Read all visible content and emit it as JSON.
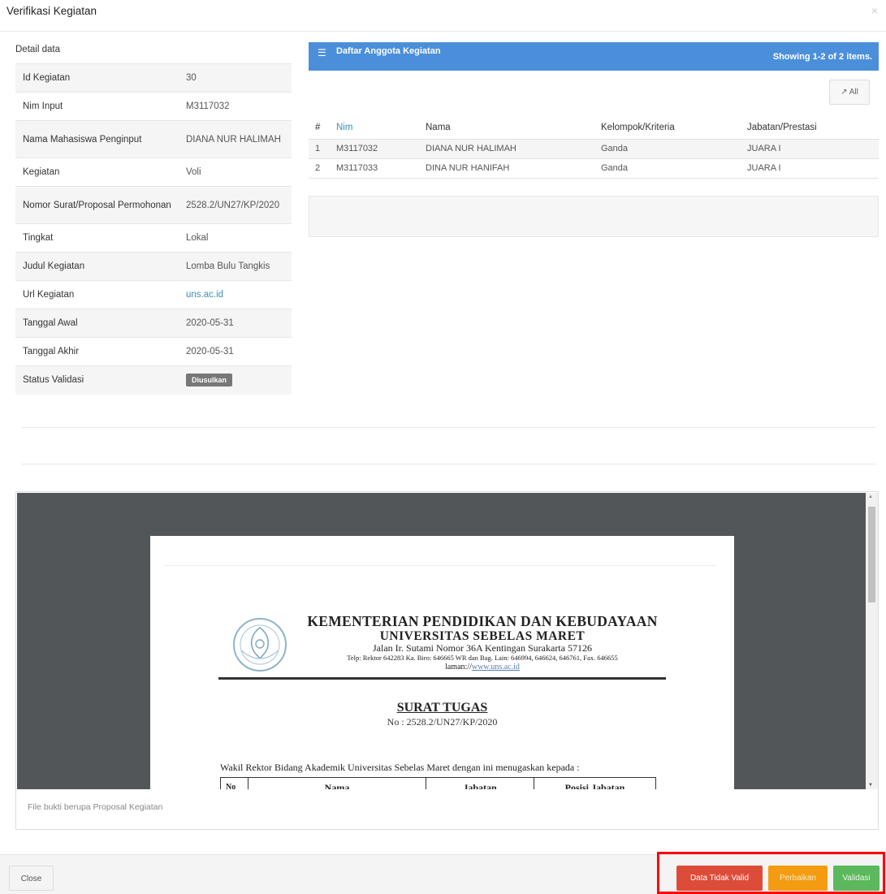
{
  "modal": {
    "title": "Verifikasi Kegiatan",
    "close_glyph": "×"
  },
  "detail": {
    "caption": "Detail data",
    "rows": [
      {
        "label": "Id Kegiatan",
        "value": "30"
      },
      {
        "label": "Nim Input",
        "value": "M3117032"
      },
      {
        "label": "Nama Mahasiswa Penginput",
        "value": "DIANA NUR HALIMAH"
      },
      {
        "label": "Kegiatan",
        "value": "Voli"
      },
      {
        "label": "Nomor Surat/Proposal Permohonan",
        "value": "2528.2/UN27/KP/2020"
      },
      {
        "label": "Tingkat",
        "value": "Lokal"
      },
      {
        "label": "Judul Kegiatan",
        "value": "Lomba Bulu Tangkis"
      },
      {
        "label": "Url Kegiatan",
        "value": "uns.ac.id"
      },
      {
        "label": "Tanggal Awal",
        "value": "2020-05-31"
      },
      {
        "label": "Tanggal Akhir",
        "value": "2020-05-31"
      },
      {
        "label": "Status Validasi",
        "value": "Diusulkan"
      }
    ]
  },
  "anggota": {
    "title": "Daftar Anggota Kegiatan",
    "summary": "Showing 1-2 of 2 items.",
    "expand_label": "All",
    "columns": [
      "#",
      "Nim",
      "Nama",
      "Kelompok/Kriteria",
      "Jabatan/Prestasi"
    ],
    "rows": [
      {
        "no": "1",
        "nim": "M3117032",
        "nama": "DIANA NUR HALIMAH",
        "kelompok": "Ganda",
        "jabatan": "JUARA I"
      },
      {
        "no": "2",
        "nim": "M3117033",
        "nama": "DINA NUR HANIFAH",
        "kelompok": "Ganda",
        "jabatan": "JUARA I"
      }
    ]
  },
  "document": {
    "line1": "KEMENTERIAN PENDIDIKAN DAN KEBUDAYAAN",
    "line2": "UNIVERSITAS SEBELAS MARET",
    "line3": "Jalan Ir. Sutami Nomor 36A Kentingan Surakarta 57126",
    "line4": "Telp: Rektor 642283 Ka. Biro: 646665 WR dan Bag. Lain: 646994, 646624, 646761, Fax. 646655",
    "line5_prefix": "laman://",
    "line5_url": "www.uns.ac.id",
    "title": "SURAT TUGAS",
    "number": "No : 2528.2/UN27/KP/2020",
    "intro": "Wakil Rektor Bidang Akademik Universitas Sebelas Maret dengan ini menugaskan kepada :",
    "table_headers": {
      "no": "No",
      "nama": "Nama",
      "jabatan": "Jabatan",
      "posisi": "Posisi Jabatan"
    }
  },
  "viewer_caption": "File bukti berupa Proposal Kegiatan",
  "footer": {
    "close": "Close",
    "invalid": "Data Tidak Valid",
    "fix": "Perbaikan",
    "valid": "Validasi"
  },
  "colors": {
    "panel_header": "#4b8fdb",
    "link": "#3c8dbc",
    "danger": "#dd4b39",
    "warning": "#f39c12",
    "success": "#5cb85c",
    "badge": "#777777",
    "viewer_bg": "#525659",
    "highlight_box": "#ff0000"
  }
}
